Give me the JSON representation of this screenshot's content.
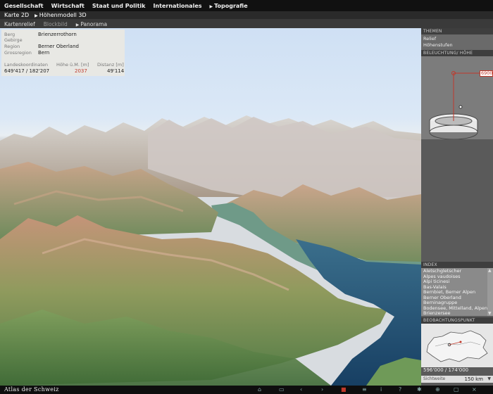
{
  "topnav": {
    "items": [
      "Gesellschaft",
      "Wirtschaft",
      "Staat und Politik",
      "Internationales",
      "Topografie"
    ]
  },
  "subnav": {
    "items": [
      "Karte 2D",
      "Höhenmodell 3D"
    ]
  },
  "subnav2": {
    "items": [
      "Kartenrelief",
      "Blockbild",
      "Panorama"
    ]
  },
  "info": {
    "labels": [
      "Berg",
      "Gebirge",
      "Region",
      "Grossregion"
    ],
    "values": [
      "Brienzerrothorn",
      "",
      "Berner Oberland",
      "Bern"
    ],
    "headers": [
      "Landeskoordinaten",
      "Höhe ü.M. [m]",
      "Distanz [m]"
    ],
    "coords": "649'417 / 182'207",
    "height": "2037",
    "distance": "49'114"
  },
  "sidebar": {
    "themen_title": "THEMEN",
    "themen_items": [
      "Relief",
      "Höhenstufen"
    ],
    "light_title": "BELEUCHTUNG/ HÖHE",
    "light_height": "6900",
    "index_title": "INDEX",
    "index_items": [
      "Aletschgletscher",
      "Alpes vaudoises",
      "Alpi ticinesi",
      "Bas-Valais",
      "Bernbiet, Berner Alpen",
      "Berner Oberland",
      "Berninagruppe",
      "Bodensee, Mittelland, Alpen",
      "Brienzersee"
    ],
    "obs_title": "BEOBACHTUNGSPUNKT",
    "obs_coords": "596'000 / 174'000",
    "sicht_label": "Sichtweite",
    "sicht_value": "150 km"
  },
  "bottom": {
    "brand": "Atlas der Schweiz"
  },
  "colors": {
    "accent_red": "#c0392b",
    "lake": "#1f4f73",
    "sky": "#d7e5f4"
  }
}
